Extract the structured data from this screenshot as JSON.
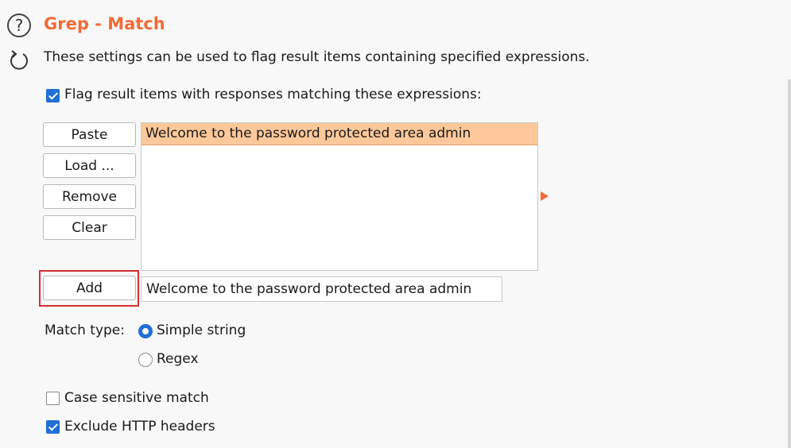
{
  "header": {
    "title": "Grep - Match",
    "description": "These settings can be used to flag result items containing specified expressions."
  },
  "icons": {
    "help": "question-mark-circle",
    "refresh": "refresh-arrow"
  },
  "flag_option": {
    "label": "Flag result items with responses matching these expressions:",
    "checked": true
  },
  "buttons": {
    "paste": "Paste",
    "load": "Load ...",
    "remove": "Remove",
    "clear": "Clear",
    "add": "Add"
  },
  "expressions": [
    "Welcome to the password protected area admin"
  ],
  "add_input": {
    "value": "Welcome to the password protected area admin"
  },
  "match_type": {
    "label": "Match type:",
    "options": [
      "Simple string",
      "Regex"
    ],
    "selected": "Simple string"
  },
  "case_sensitive": {
    "label": "Case sensitive match",
    "checked": false
  },
  "exclude_headers": {
    "label": "Exclude HTTP headers",
    "checked": true
  },
  "colors": {
    "accent": "#f26b36",
    "selection": "#fec89a",
    "checkbox": "#1f6fd6",
    "highlight_border": "#d32f2f"
  }
}
